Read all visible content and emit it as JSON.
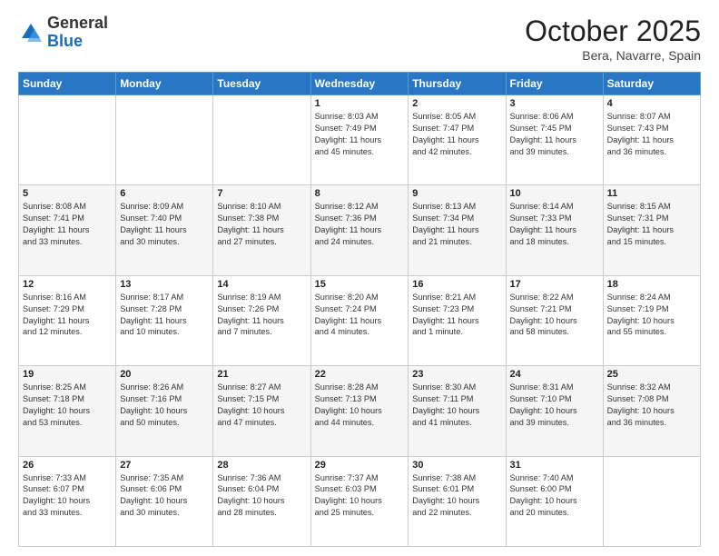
{
  "header": {
    "logo_general": "General",
    "logo_blue": "Blue",
    "month_title": "October 2025",
    "location": "Bera, Navarre, Spain"
  },
  "weekdays": [
    "Sunday",
    "Monday",
    "Tuesday",
    "Wednesday",
    "Thursday",
    "Friday",
    "Saturday"
  ],
  "weeks": [
    [
      {
        "day": "",
        "info": ""
      },
      {
        "day": "",
        "info": ""
      },
      {
        "day": "",
        "info": ""
      },
      {
        "day": "1",
        "info": "Sunrise: 8:03 AM\nSunset: 7:49 PM\nDaylight: 11 hours\nand 45 minutes."
      },
      {
        "day": "2",
        "info": "Sunrise: 8:05 AM\nSunset: 7:47 PM\nDaylight: 11 hours\nand 42 minutes."
      },
      {
        "day": "3",
        "info": "Sunrise: 8:06 AM\nSunset: 7:45 PM\nDaylight: 11 hours\nand 39 minutes."
      },
      {
        "day": "4",
        "info": "Sunrise: 8:07 AM\nSunset: 7:43 PM\nDaylight: 11 hours\nand 36 minutes."
      }
    ],
    [
      {
        "day": "5",
        "info": "Sunrise: 8:08 AM\nSunset: 7:41 PM\nDaylight: 11 hours\nand 33 minutes."
      },
      {
        "day": "6",
        "info": "Sunrise: 8:09 AM\nSunset: 7:40 PM\nDaylight: 11 hours\nand 30 minutes."
      },
      {
        "day": "7",
        "info": "Sunrise: 8:10 AM\nSunset: 7:38 PM\nDaylight: 11 hours\nand 27 minutes."
      },
      {
        "day": "8",
        "info": "Sunrise: 8:12 AM\nSunset: 7:36 PM\nDaylight: 11 hours\nand 24 minutes."
      },
      {
        "day": "9",
        "info": "Sunrise: 8:13 AM\nSunset: 7:34 PM\nDaylight: 11 hours\nand 21 minutes."
      },
      {
        "day": "10",
        "info": "Sunrise: 8:14 AM\nSunset: 7:33 PM\nDaylight: 11 hours\nand 18 minutes."
      },
      {
        "day": "11",
        "info": "Sunrise: 8:15 AM\nSunset: 7:31 PM\nDaylight: 11 hours\nand 15 minutes."
      }
    ],
    [
      {
        "day": "12",
        "info": "Sunrise: 8:16 AM\nSunset: 7:29 PM\nDaylight: 11 hours\nand 12 minutes."
      },
      {
        "day": "13",
        "info": "Sunrise: 8:17 AM\nSunset: 7:28 PM\nDaylight: 11 hours\nand 10 minutes."
      },
      {
        "day": "14",
        "info": "Sunrise: 8:19 AM\nSunset: 7:26 PM\nDaylight: 11 hours\nand 7 minutes."
      },
      {
        "day": "15",
        "info": "Sunrise: 8:20 AM\nSunset: 7:24 PM\nDaylight: 11 hours\nand 4 minutes."
      },
      {
        "day": "16",
        "info": "Sunrise: 8:21 AM\nSunset: 7:23 PM\nDaylight: 11 hours\nand 1 minute."
      },
      {
        "day": "17",
        "info": "Sunrise: 8:22 AM\nSunset: 7:21 PM\nDaylight: 10 hours\nand 58 minutes."
      },
      {
        "day": "18",
        "info": "Sunrise: 8:24 AM\nSunset: 7:19 PM\nDaylight: 10 hours\nand 55 minutes."
      }
    ],
    [
      {
        "day": "19",
        "info": "Sunrise: 8:25 AM\nSunset: 7:18 PM\nDaylight: 10 hours\nand 53 minutes."
      },
      {
        "day": "20",
        "info": "Sunrise: 8:26 AM\nSunset: 7:16 PM\nDaylight: 10 hours\nand 50 minutes."
      },
      {
        "day": "21",
        "info": "Sunrise: 8:27 AM\nSunset: 7:15 PM\nDaylight: 10 hours\nand 47 minutes."
      },
      {
        "day": "22",
        "info": "Sunrise: 8:28 AM\nSunset: 7:13 PM\nDaylight: 10 hours\nand 44 minutes."
      },
      {
        "day": "23",
        "info": "Sunrise: 8:30 AM\nSunset: 7:11 PM\nDaylight: 10 hours\nand 41 minutes."
      },
      {
        "day": "24",
        "info": "Sunrise: 8:31 AM\nSunset: 7:10 PM\nDaylight: 10 hours\nand 39 minutes."
      },
      {
        "day": "25",
        "info": "Sunrise: 8:32 AM\nSunset: 7:08 PM\nDaylight: 10 hours\nand 36 minutes."
      }
    ],
    [
      {
        "day": "26",
        "info": "Sunrise: 7:33 AM\nSunset: 6:07 PM\nDaylight: 10 hours\nand 33 minutes."
      },
      {
        "day": "27",
        "info": "Sunrise: 7:35 AM\nSunset: 6:06 PM\nDaylight: 10 hours\nand 30 minutes."
      },
      {
        "day": "28",
        "info": "Sunrise: 7:36 AM\nSunset: 6:04 PM\nDaylight: 10 hours\nand 28 minutes."
      },
      {
        "day": "29",
        "info": "Sunrise: 7:37 AM\nSunset: 6:03 PM\nDaylight: 10 hours\nand 25 minutes."
      },
      {
        "day": "30",
        "info": "Sunrise: 7:38 AM\nSunset: 6:01 PM\nDaylight: 10 hours\nand 22 minutes."
      },
      {
        "day": "31",
        "info": "Sunrise: 7:40 AM\nSunset: 6:00 PM\nDaylight: 10 hours\nand 20 minutes."
      },
      {
        "day": "",
        "info": ""
      }
    ]
  ]
}
